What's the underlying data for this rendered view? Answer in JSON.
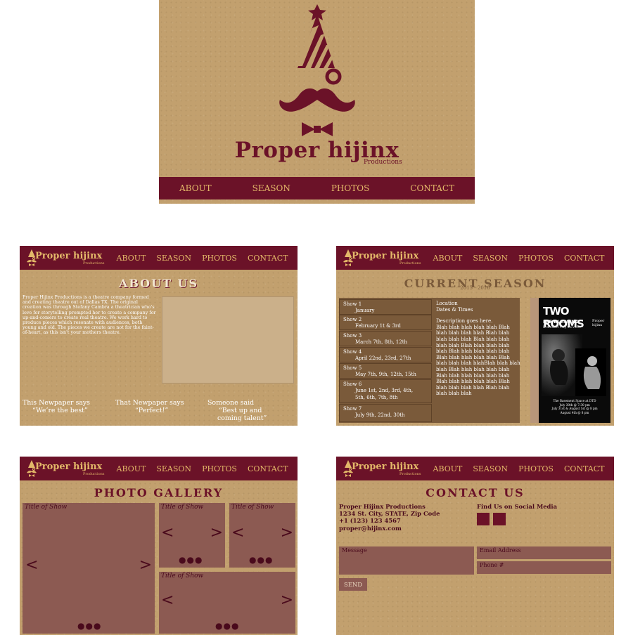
{
  "hero": {
    "brand": "Proper hijinx",
    "sub": "Productions",
    "nav": [
      "ABOUT",
      "SEASON",
      "PHOTOS",
      "CONTACT"
    ]
  },
  "header": {
    "brand": "Proper hijinx",
    "sub": "Productions",
    "nav": [
      "ABOUT",
      "SEASON",
      "PHOTOS",
      "CONTACT"
    ]
  },
  "about": {
    "title": "ABOUT US",
    "body": "Proper Hijinx Productions is a theatre company formed and creating theatre out of Dallas TX. The original creation was through Stefany Cambra a theatrician who's love for storytelling prompted her to create a company for up-and-comers to create real theatre. We work hard to produce pieces which resonate with audiences, both young and old. The pieces we create are not for the faint-of-heart, as this isn't your mothers theatre.",
    "quotes": [
      {
        "l1": "This Newpaper says",
        "l2": "“We’re the best”"
      },
      {
        "l1": "That Newpaper says",
        "l2": "“Perfect!”"
      },
      {
        "l1": "Someone said",
        "l2": "“Best up and",
        "l3": "coming talent”"
      }
    ]
  },
  "season": {
    "title": "CURRENT SEASON",
    "years": "2015 - 2016",
    "shows": [
      {
        "name": "Show 1",
        "dates": "January"
      },
      {
        "name": "Show 2",
        "dates": "February 1t & 3rd"
      },
      {
        "name": "Show 3",
        "dates": "March 7th, 8th, 12th"
      },
      {
        "name": "Show 4",
        "dates": "April 22nd, 23rd, 27th"
      },
      {
        "name": "Show 5",
        "dates": "May 7th, 9th, 12th, 15th"
      },
      {
        "name": "Show 6",
        "dates": "June 1st, 2nd, 3rd, 4th,",
        "dates2": "5th, 6th, 7th, 8th"
      },
      {
        "name": "Show 7",
        "dates": "July 9th, 22nd, 30th"
      }
    ],
    "detail": {
      "location": "Location",
      "dates_times": "Dates & Times",
      "desc": "Description goes here.",
      "blah": "Blah blah blah blah blah Blah blah blah blah blah Blah blah blah blah blah Blah blah blah blah blah Blah blah blah blah blah Blah blah blah blah blah Blah blah blah blah blah Blah blah blah blah blahBlah blah blah blah Blah blah blah blah blah Blah blah blah blah blah blah Blah blah blah blah blah Blah blah blah blah blah Blah blah blah blah blah"
    },
    "poster": {
      "title": "TWO ROOMS",
      "author": "LEE BLESSING",
      "tagline": "Dramatist Play Services",
      "presenter": "Proper hijinx",
      "info1": "The Basement Space at DTD",
      "info2": "July 30th @ 7:30 pm",
      "info3": "July 31st & August 1st @ 8 pm",
      "info4": "August 4th @ 8 pm"
    }
  },
  "gallery": {
    "title": "PHOTO GALLERY",
    "item_title": "Title of Show",
    "prev": "<",
    "next": ">",
    "dots": "●●●"
  },
  "contact": {
    "title": "CONTACT US",
    "company": "Proper Hijinx Productions",
    "address": "1234 St. City, STATE, Zip Code",
    "phone": "+1 (123) 123 4567",
    "email": "proper@hijinx.com",
    "social_label": "Find Us on Social Media",
    "message_label": "Message",
    "email_label": "Email Address",
    "phone_label": "Phone #",
    "send_label": "SEND"
  },
  "colors": {
    "maroon": "#6b1228",
    "kraft": "#c2a06e",
    "gold": "#e3b869",
    "brown_panel": "#7a5a3a",
    "gallery_box": "#8c5a52"
  }
}
